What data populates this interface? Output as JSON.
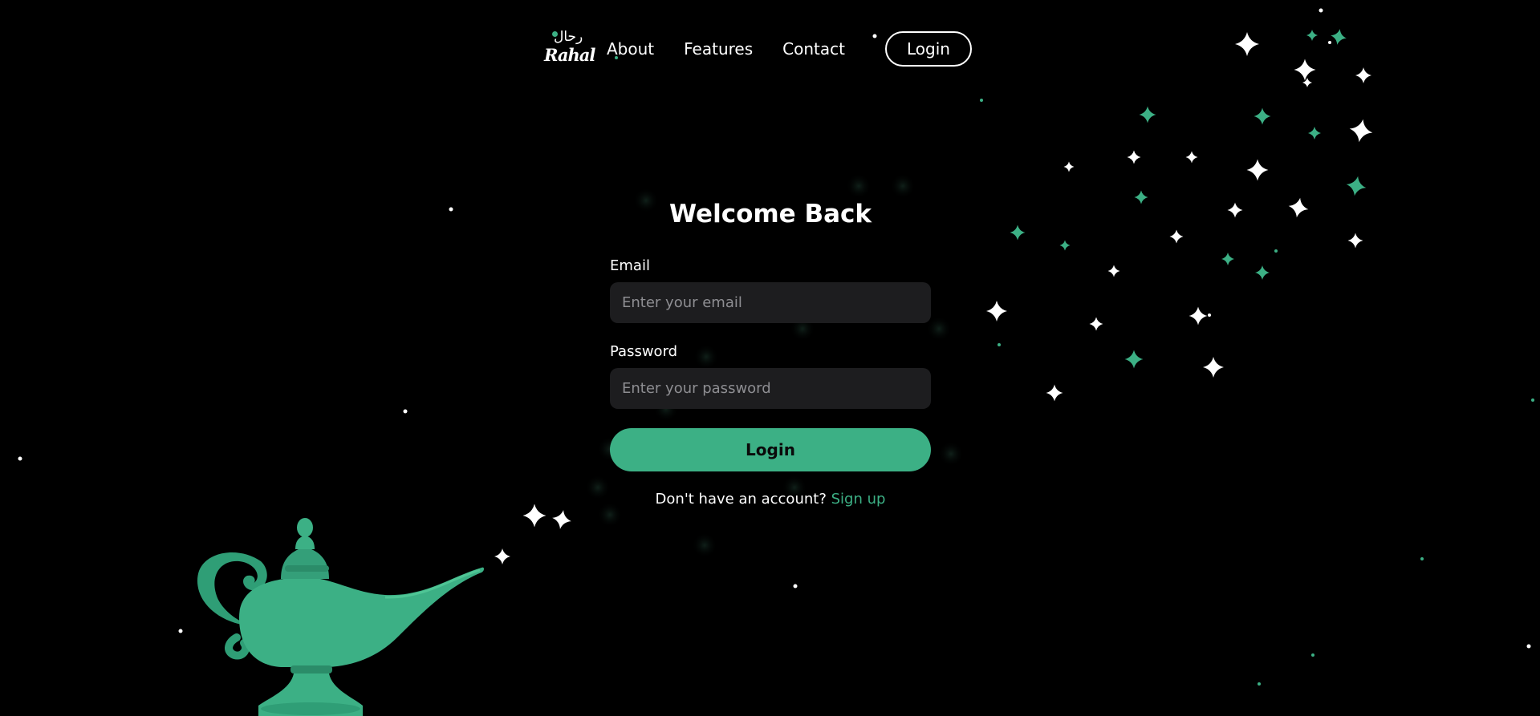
{
  "brand": {
    "logo_arabic": "رحال",
    "logo_latin": "Rahal"
  },
  "nav": {
    "items": [
      {
        "label": "About"
      },
      {
        "label": "Features"
      },
      {
        "label": "Contact"
      }
    ],
    "login_label": "Login"
  },
  "form": {
    "title": "Welcome Back",
    "email_label": "Email",
    "email_placeholder": "Enter your email",
    "password_label": "Password",
    "password_placeholder": "Enter your password",
    "submit_label": "Login",
    "signup_prompt": "Don't have an account?",
    "signup_link": "Sign up"
  },
  "theme": {
    "background": "#000000",
    "accent": "#3cb085",
    "input_bg": "#1d1d1f",
    "text": "#ffffff"
  },
  "icons": {
    "lamp": "magic-lamp-icon",
    "sparkle": "sparkle-icon"
  }
}
